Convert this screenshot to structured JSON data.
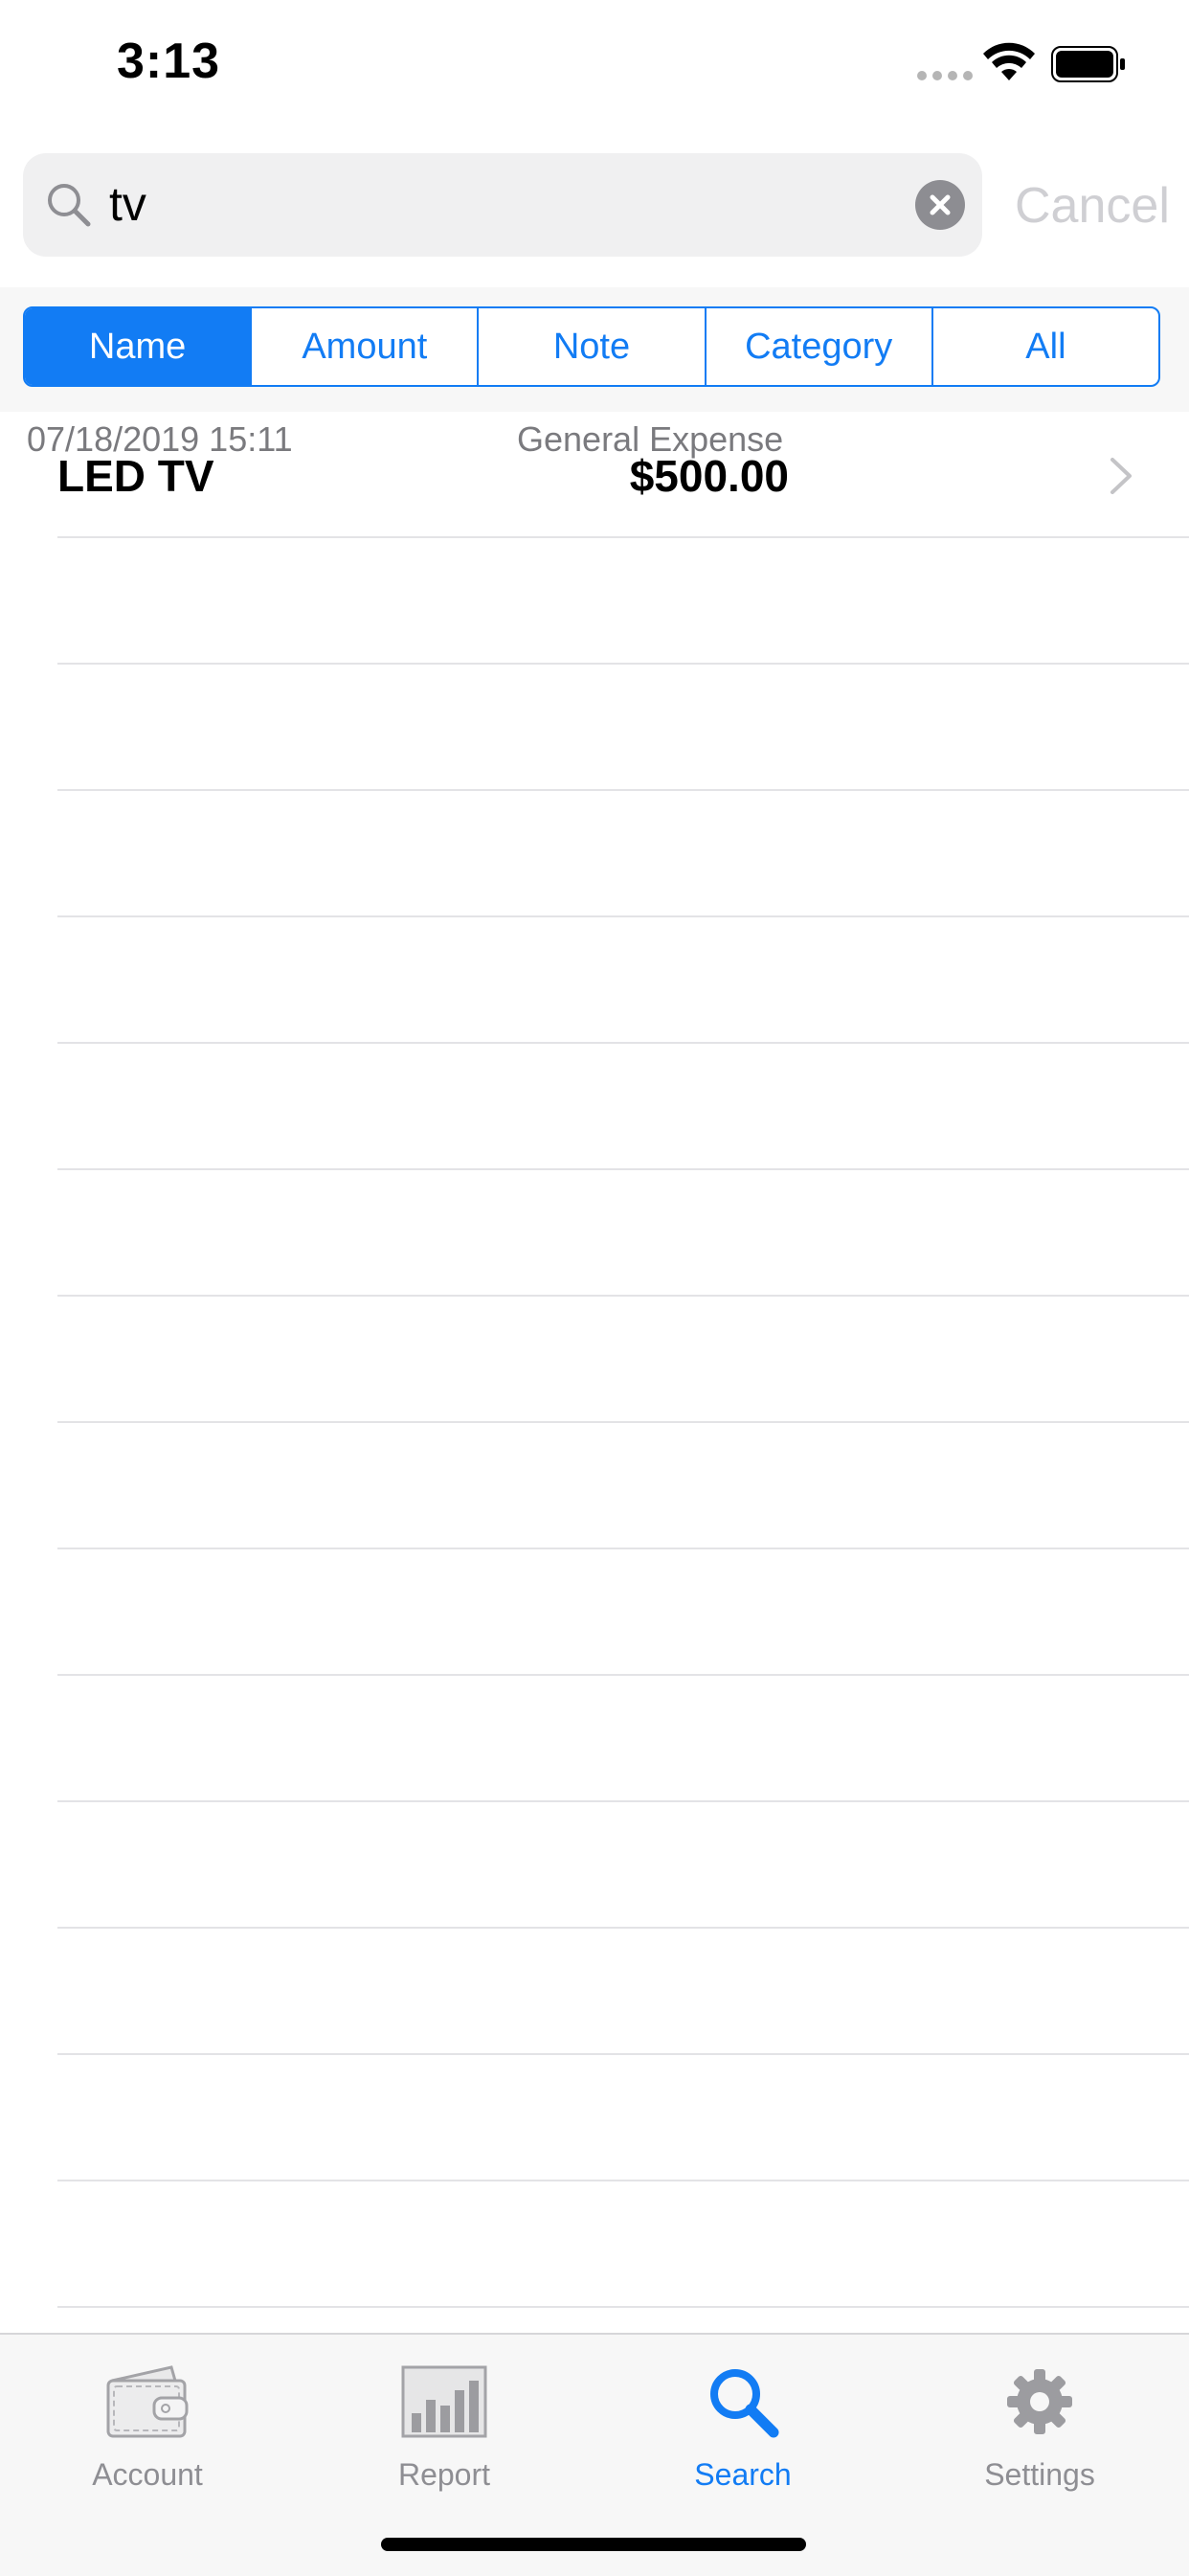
{
  "status": {
    "time": "3:13"
  },
  "search": {
    "query": "tv",
    "cancel_label": "Cancel"
  },
  "segments": [
    {
      "label": "Name",
      "active": true
    },
    {
      "label": "Amount",
      "active": false
    },
    {
      "label": "Note",
      "active": false
    },
    {
      "label": "Category",
      "active": false
    },
    {
      "label": "All",
      "active": false
    }
  ],
  "results": [
    {
      "date": "07/18/2019 15:11",
      "category": "General Expense",
      "name": "LED TV",
      "amount": "$500.00"
    }
  ],
  "tabs": [
    {
      "label": "Account",
      "icon": "wallet-icon",
      "active": false
    },
    {
      "label": "Report",
      "icon": "bar-chart-icon",
      "active": false
    },
    {
      "label": "Search",
      "icon": "search-icon",
      "active": true
    },
    {
      "label": "Settings",
      "icon": "gear-icon",
      "active": false
    }
  ],
  "colors": {
    "accent": "#127cf4",
    "inactive_tab": "#8e8e93",
    "separator": "#e3e3e6"
  }
}
